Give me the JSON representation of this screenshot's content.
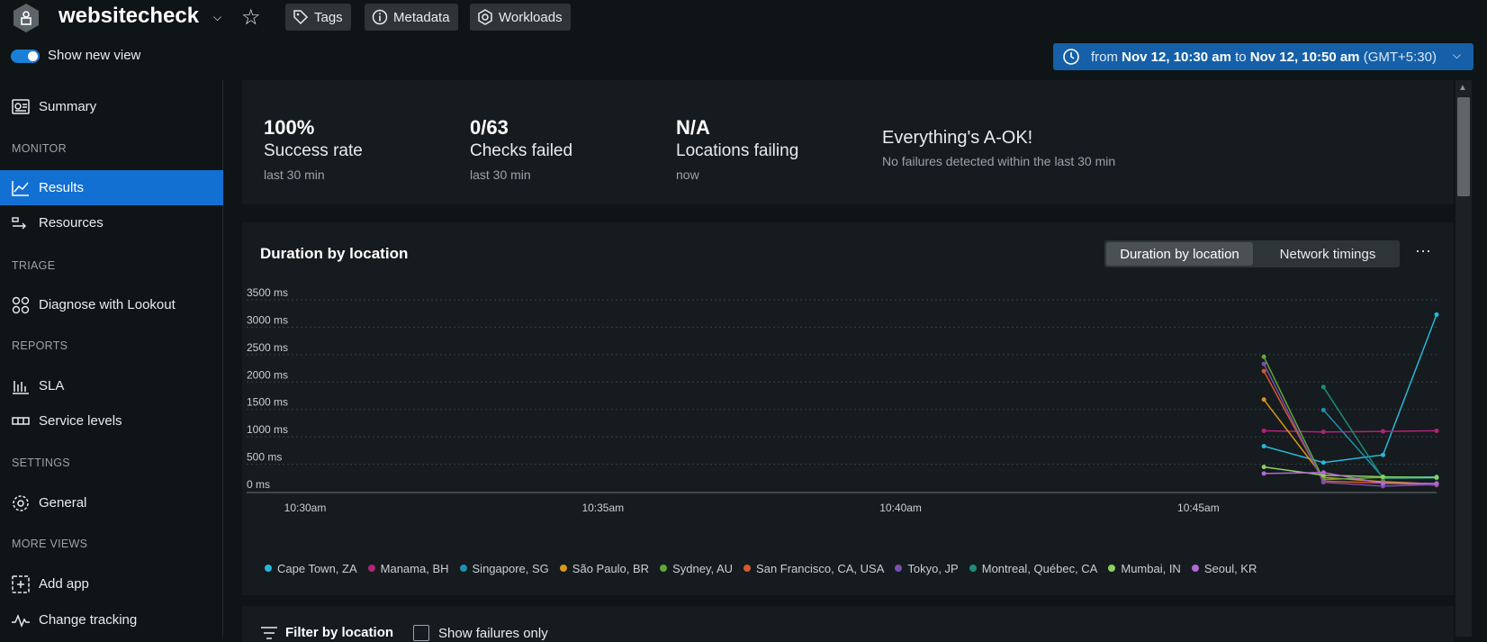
{
  "header": {
    "app_title": "websitecheck",
    "buttons": [
      {
        "label": "Tags",
        "icon": "tag-icon"
      },
      {
        "label": "Metadata",
        "icon": "info-icon"
      },
      {
        "label": "Workloads",
        "icon": "hexagon-icon"
      }
    ],
    "new_view_label": "Show new view",
    "new_view_enabled": true,
    "time_range": {
      "prefix": "from",
      "start": "Nov 12, 10:30 am",
      "middle": "to",
      "end": "Nov 12, 10:50 am",
      "tz": "(GMT+5:30)"
    }
  },
  "sidebar": {
    "summary": "Summary",
    "monitor_head": "MONITOR",
    "results": "Results",
    "resources": "Resources",
    "triage_head": "TRIAGE",
    "diagnose": "Diagnose with Lookout",
    "reports_head": "REPORTS",
    "sla": "SLA",
    "service_levels": "Service levels",
    "settings_head": "SETTINGS",
    "general": "General",
    "more_head": "MORE VIEWS",
    "add_app": "Add app",
    "change_tracking": "Change tracking"
  },
  "stats": [
    {
      "value": "100%",
      "label": "Success rate",
      "sub": "last 30 min"
    },
    {
      "value": "0/63",
      "label": "Checks failed",
      "sub": "last 30 min"
    },
    {
      "value": "N/A",
      "label": "Locations failing",
      "sub": "now"
    }
  ],
  "status": {
    "title": "Everything's A-OK!",
    "sub": "No failures detected within the last 30 min"
  },
  "chart_panel": {
    "title": "Duration by location",
    "seg_active": "Duration by location",
    "seg_other": "Network timings",
    "more": "···"
  },
  "chart_data": {
    "type": "line",
    "yticks": [
      "3500 ms",
      "3000 ms",
      "2500 ms",
      "2000 ms",
      "1500 ms",
      "1000 ms",
      "500 ms",
      "0 ms"
    ],
    "ylim": [
      0,
      3500
    ],
    "xticks": [
      "10:30am",
      "10:35am",
      "10:40am",
      "10:45am"
    ],
    "xlim_minutes": [
      0,
      19
    ],
    "grid": true,
    "series": [
      {
        "name": "Cape Town, ZA",
        "color": "#29b6d9",
        "points": [
          [
            16.1,
            830
          ],
          [
            17.1,
            530
          ],
          [
            18.1,
            670
          ],
          [
            19.0,
            3230
          ]
        ]
      },
      {
        "name": "Manama, BH",
        "color": "#b2237a",
        "points": [
          [
            16.1,
            1110
          ],
          [
            17.1,
            1090
          ],
          [
            18.1,
            1100
          ],
          [
            19.0,
            1110
          ]
        ]
      },
      {
        "name": "Singapore, SG",
        "color": "#1f8fb0",
        "points": [
          [
            17.1,
            1490
          ],
          [
            18.1,
            260
          ],
          [
            19.0,
            270
          ]
        ]
      },
      {
        "name": "São Paulo, BR",
        "color": "#d9971a",
        "points": [
          [
            16.1,
            1680
          ],
          [
            17.1,
            260
          ],
          [
            18.1,
            180
          ],
          [
            19.0,
            140
          ]
        ]
      },
      {
        "name": "Sydney, AU",
        "color": "#5fa838",
        "points": [
          [
            16.1,
            2460
          ],
          [
            17.1,
            220
          ],
          [
            18.1,
            260
          ],
          [
            19.0,
            250
          ]
        ]
      },
      {
        "name": "San Francisco, CA, USA",
        "color": "#d65a2f",
        "points": [
          [
            16.1,
            2200
          ],
          [
            17.1,
            190
          ],
          [
            18.1,
            160
          ],
          [
            19.0,
            120
          ]
        ]
      },
      {
        "name": "Tokyo, JP",
        "color": "#7b4fb0",
        "points": [
          [
            16.1,
            2330
          ],
          [
            17.1,
            170
          ],
          [
            18.1,
            100
          ],
          [
            19.0,
            130
          ]
        ]
      },
      {
        "name": "Montreal, Québec, CA",
        "color": "#1d8c77",
        "points": [
          [
            17.1,
            1910
          ],
          [
            18.1,
            240
          ],
          [
            19.0,
            250
          ]
        ]
      },
      {
        "name": "Mumbai, IN",
        "color": "#8dd15a",
        "points": [
          [
            16.1,
            450
          ],
          [
            17.1,
            300
          ],
          [
            18.1,
            270
          ],
          [
            19.0,
            260
          ]
        ]
      },
      {
        "name": "Seoul, KR",
        "color": "#b268d6",
        "points": [
          [
            16.1,
            330
          ],
          [
            17.1,
            350
          ],
          [
            18.1,
            150
          ],
          [
            19.0,
            150
          ]
        ]
      }
    ]
  },
  "footer": {
    "filter": "Filter by location",
    "fail_only": "Show failures only"
  }
}
